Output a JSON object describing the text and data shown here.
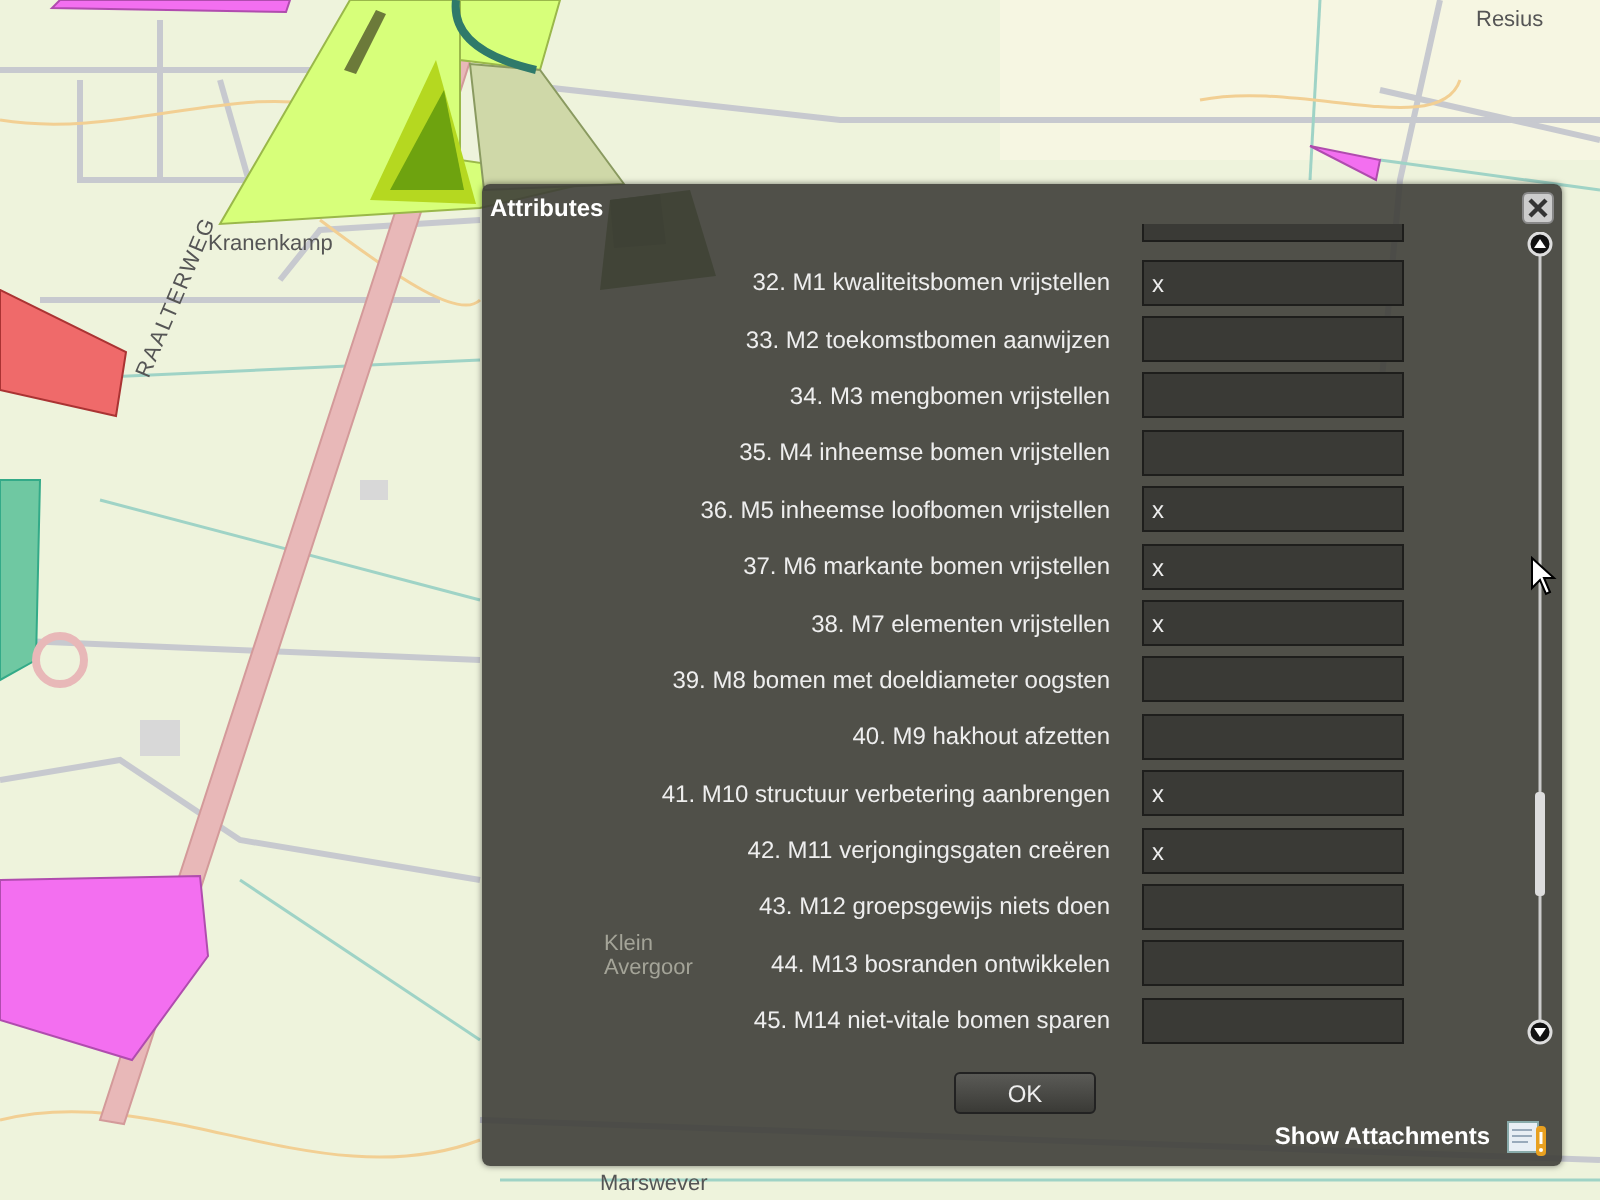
{
  "map": {
    "labels": [
      {
        "text": "Kranenkamp",
        "kind": "place"
      },
      {
        "text": "RAALTERWEG",
        "kind": "road"
      },
      {
        "text": "Resius",
        "kind": "place"
      },
      {
        "text": "Klein Avergoor",
        "kind": "place"
      },
      {
        "text": "Marswever",
        "kind": "place"
      }
    ]
  },
  "dialog": {
    "title": "Attributes",
    "fields": [
      {
        "label": "32. M1 kwaliteitsbomen vrijstellen",
        "value": "x"
      },
      {
        "label": "33. M2 toekomstbomen aanwijzen"
      },
      {
        "label": "34. M3 mengbomen vrijstellen"
      },
      {
        "label": "35. M4 inheemse bomen vrijstellen"
      },
      {
        "label": "36. M5 inheemse loofbomen vrijstellen",
        "value": "x"
      },
      {
        "label": "37. M6 markante bomen vrijstellen",
        "value": "x"
      },
      {
        "label": "38. M7 elementen vrijstellen",
        "value": "x"
      },
      {
        "label": "39. M8 bomen met doeldiameter oogsten"
      },
      {
        "label": "40. M9 hakhout afzetten"
      },
      {
        "label": "41. M10 structuur verbetering aanbrengen",
        "value": "x"
      },
      {
        "label": "42. M11 verjongingsgaten creëren",
        "value": "x"
      },
      {
        "label": "43. M12 groepsgewijs niets doen"
      },
      {
        "label": "44. M13 bosranden ontwikkelen"
      },
      {
        "label": "45. M14 niet-vitale bomen sparen"
      }
    ],
    "ok_button": "OK",
    "attachments_link": "Show Attachments"
  }
}
